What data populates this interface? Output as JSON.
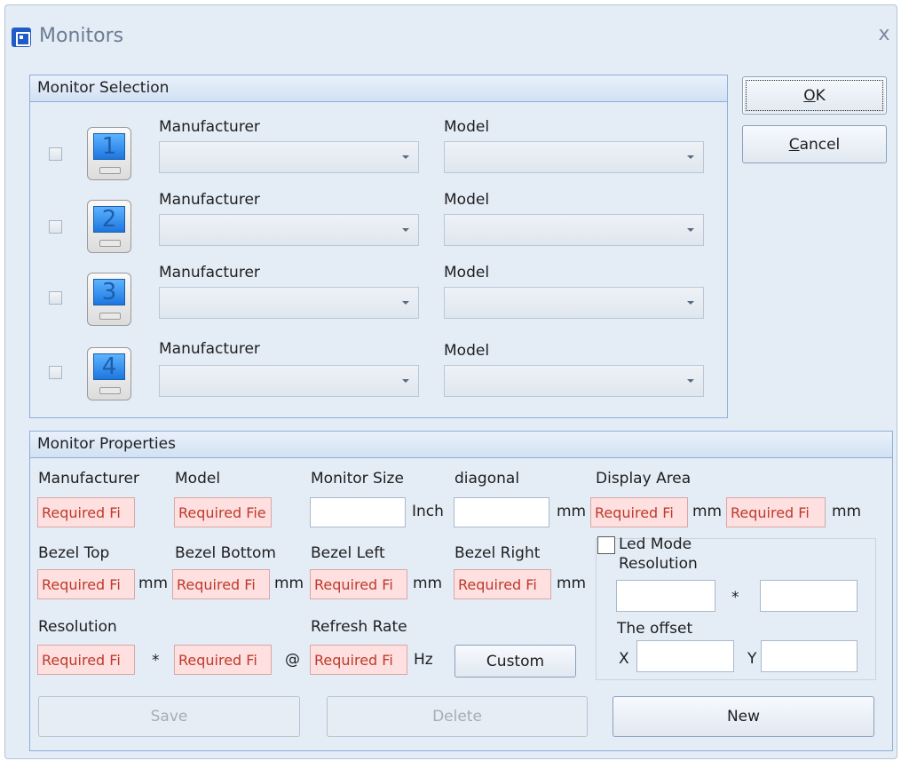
{
  "window": {
    "title": "Monitors",
    "close": "x"
  },
  "buttons": {
    "ok_mnemonic": "O",
    "ok_rest": "K",
    "cancel_mnemonic": "C",
    "cancel_rest": "ancel"
  },
  "selection": {
    "header": "Monitor Selection",
    "rows": [
      {
        "number": "1",
        "manufacturer_label": "Manufacturer",
        "model_label": "Model"
      },
      {
        "number": "2",
        "manufacturer_label": "Manufacturer",
        "model_label": "Model"
      },
      {
        "number": "3",
        "manufacturer_label": "Manufacturer",
        "model_label": "Model"
      },
      {
        "number": "4",
        "manufacturer_label": "Manufacturer",
        "model_label": "Model"
      }
    ]
  },
  "properties": {
    "header": "Monitor Properties",
    "labels": {
      "manufacturer": "Manufacturer",
      "model": "Model",
      "monitor_size": "Monitor Size",
      "diagonal": "diagonal",
      "display_area": "Display Area",
      "bezel_top": "Bezel Top",
      "bezel_bottom": "Bezel Bottom",
      "bezel_left": "Bezel Left",
      "bezel_right": "Bezel Right",
      "resolution": "Resolution",
      "refresh_rate": "Refresh Rate"
    },
    "units": {
      "inch": "Inch",
      "mm": "mm",
      "hz": "Hz",
      "times": "*",
      "at": "@"
    },
    "required_display": {
      "short": "Required Fi",
      "model": "Required Fie"
    },
    "custom_button": "Custom",
    "led": {
      "checkbox_label": "Led Mode",
      "resolution_label": "Resolution",
      "times": "*",
      "offset_label": "The offset",
      "x_label": "X",
      "y_label": "Y"
    },
    "actions": {
      "save": "Save",
      "delete": "Delete",
      "new": "New"
    }
  },
  "colors": {
    "window_bg": "#e4ecf6",
    "group_border": "#8eaedb",
    "required_bg": "#fde0df",
    "required_text": "#c0392b"
  },
  "icons": [
    "app-icon",
    "close-icon",
    "monitor-icon",
    "dropdown-arrow-icon"
  ]
}
